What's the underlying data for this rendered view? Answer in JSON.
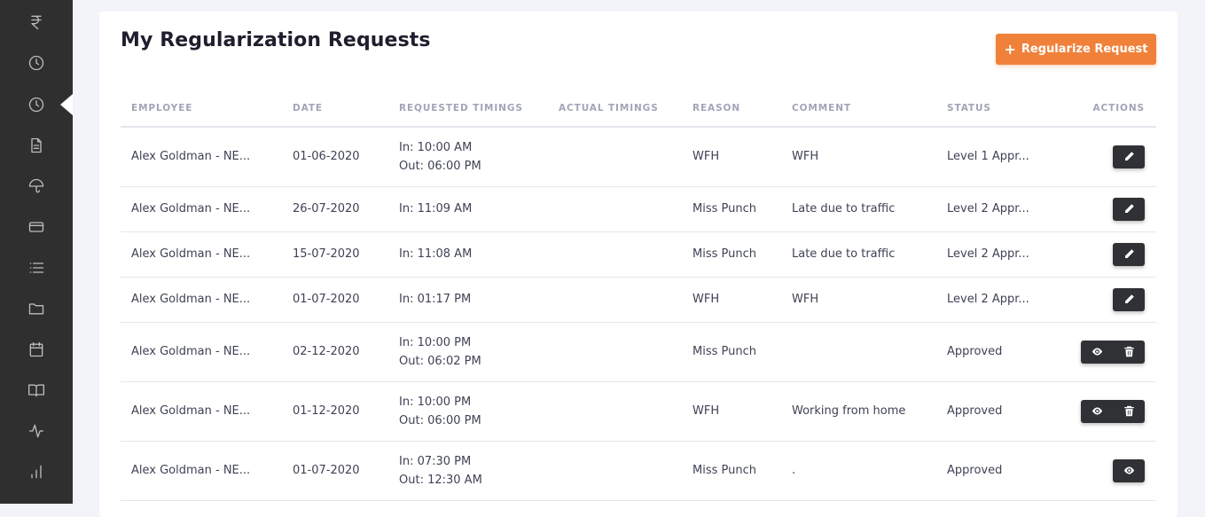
{
  "sidebar": {
    "items": [
      {
        "icon": "rupee-icon"
      },
      {
        "icon": "clock-icon"
      },
      {
        "icon": "clock-icon",
        "active": true
      },
      {
        "icon": "document-icon"
      },
      {
        "icon": "umbrella-icon"
      },
      {
        "icon": "credit-card-icon"
      },
      {
        "icon": "list-icon"
      },
      {
        "icon": "folder-icon"
      },
      {
        "icon": "calendar-icon"
      },
      {
        "icon": "book-icon"
      },
      {
        "icon": "activity-icon"
      },
      {
        "icon": "bar-chart-icon"
      }
    ]
  },
  "page": {
    "title": "My Regularization Requests",
    "primary_button": "Regularize Request",
    "accent_color": "#f0813a"
  },
  "table": {
    "headers": {
      "employee": "Employee",
      "date": "Date",
      "requested": "Requested Timings",
      "actual": "Actual Timings",
      "reason": "Reason",
      "comment": "Comment",
      "status": "Status",
      "actions": "Actions"
    },
    "rows": [
      {
        "employee": "Alex Goldman - NE...",
        "date": "01-06-2020",
        "in": "In: 10:00 AM",
        "out": "Out: 06:00 PM",
        "actual": "",
        "reason": "WFH",
        "comment": "WFH",
        "status": "Level 1 Appr...",
        "actions": [
          "edit"
        ]
      },
      {
        "employee": "Alex Goldman - NE...",
        "date": "26-07-2020",
        "in": "In: 11:09 AM",
        "out": "",
        "actual": "",
        "reason": "Miss Punch",
        "comment": "Late due to traffic",
        "status": "Level 2 Appr...",
        "actions": [
          "edit"
        ]
      },
      {
        "employee": "Alex Goldman - NE...",
        "date": "15-07-2020",
        "in": "In: 11:08 AM",
        "out": "",
        "actual": "",
        "reason": "Miss Punch",
        "comment": "Late due to traffic",
        "status": "Level 2 Appr...",
        "actions": [
          "edit"
        ]
      },
      {
        "employee": "Alex Goldman - NE...",
        "date": "01-07-2020",
        "in": "In: 01:17 PM",
        "out": "",
        "actual": "",
        "reason": "WFH",
        "comment": "WFH",
        "status": "Level 2 Appr...",
        "actions": [
          "edit"
        ]
      },
      {
        "employee": "Alex Goldman - NE...",
        "date": "02-12-2020",
        "in": "In: 10:00 PM",
        "out": "Out: 06:02 PM",
        "actual": "",
        "reason": "Miss Punch",
        "comment": "",
        "status": "Approved",
        "actions": [
          "view",
          "delete"
        ]
      },
      {
        "employee": "Alex Goldman - NE...",
        "date": "01-12-2020",
        "in": "In: 10:00 PM",
        "out": "Out: 06:00 PM",
        "actual": "",
        "reason": "WFH",
        "comment": "Working from home",
        "status": "Approved",
        "actions": [
          "view",
          "delete"
        ]
      },
      {
        "employee": "Alex Goldman - NE...",
        "date": "01-07-2020",
        "in": "In: 07:30 PM",
        "out": "Out: 12:30 AM",
        "actual": "",
        "reason": "Miss Punch",
        "comment": ".",
        "status": "Approved",
        "actions": [
          "view"
        ]
      }
    ]
  }
}
